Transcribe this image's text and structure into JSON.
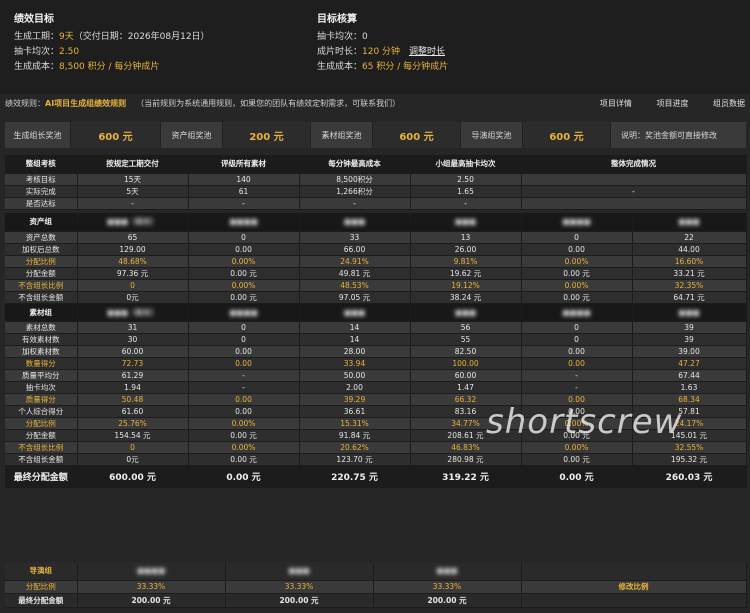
{
  "goal": {
    "title": "绩效目标",
    "rows": [
      {
        "label": "生成工期：",
        "value": "9天",
        "extra": "（交付日期：2026年08月12日）"
      },
      {
        "label": "抽卡均次：",
        "value": "2.50",
        "extra": ""
      },
      {
        "label": "生成成本：",
        "value": "8,500 积分 / 每分钟成片",
        "extra": ""
      }
    ]
  },
  "accounting": {
    "title": "目标核算",
    "rows": [
      {
        "label": "抽卡均次：",
        "value": "0",
        "link": ""
      },
      {
        "label": "成片时长：",
        "value": "120 分钟",
        "link": "调整时长"
      },
      {
        "label": "生成成本：",
        "value": "65 积分 / 每分钟成片",
        "link": ""
      }
    ]
  },
  "rules": {
    "label": "绩效规则：",
    "name": "AI项目生成组绩效规则",
    "note": "（当前规则为系统通用规则，如果您的团队有绩效定制需求，可联系我们）",
    "links": [
      "项目详情",
      "项目进度",
      "组员数据"
    ]
  },
  "pools": [
    {
      "label": "生成组长奖池",
      "value": "600 元"
    },
    {
      "label": "资产组奖池",
      "value": "200 元"
    },
    {
      "label": "素材组奖池",
      "value": "600 元"
    },
    {
      "label": "导演组奖池",
      "value": "600 元"
    }
  ],
  "pool_note": "说明：奖池金额可直接修改",
  "assessment": {
    "headers": [
      "整组考核",
      "按规定工期交付",
      "评级所有素材",
      "每分钟最高成本",
      "小组最高抽卡均次",
      "整体完成情况"
    ],
    "rows": [
      {
        "label": "考核目标",
        "cells": [
          "15天",
          "140",
          "8,500积分",
          "2.50",
          ""
        ]
      },
      {
        "label": "实际完成",
        "cells": [
          "5天",
          "61",
          "1,266积分",
          "1.65",
          "-"
        ]
      },
      {
        "label": "是否达标",
        "cells": [
          "-",
          "-",
          "-",
          "-",
          ""
        ]
      }
    ]
  },
  "asset_group": {
    "title": "资产组",
    "members": [
      "■■■（组长）",
      "■■■■",
      "■■■",
      "■■■",
      "■■■■",
      "■■■"
    ],
    "rows": [
      {
        "label": "资产总数",
        "gold": false,
        "cells": [
          "65",
          "0",
          "33",
          "13",
          "0",
          "22"
        ]
      },
      {
        "label": "加权后总数",
        "gold": false,
        "cells": [
          "129.00",
          "0.00",
          "66.00",
          "26.00",
          "0.00",
          "44.00"
        ]
      },
      {
        "label": "分配比例",
        "gold": true,
        "cells": [
          "48.68%",
          "0.00%",
          "24.91%",
          "9.81%",
          "0.00%",
          "16.60%"
        ]
      },
      {
        "label": "分配金额",
        "gold": false,
        "cells": [
          "97.36 元",
          "0.00 元",
          "49.81 元",
          "19.62 元",
          "0.00 元",
          "33.21 元"
        ]
      },
      {
        "label": "不含组长比例",
        "gold": true,
        "cells": [
          "0",
          "0.00%",
          "48.53%",
          "19.12%",
          "0.00%",
          "32.35%"
        ]
      },
      {
        "label": "不含组长金额",
        "gold": false,
        "cells": [
          "0元",
          "0.00 元",
          "97.05 元",
          "38.24 元",
          "0.00 元",
          "64.71 元"
        ]
      }
    ]
  },
  "material_group": {
    "title": "素材组",
    "members": [
      "■■■（组长）",
      "■■■■",
      "■■■",
      "■■■",
      "■■■■",
      "■■■"
    ],
    "rows": [
      {
        "label": "素材总数",
        "gold": false,
        "cells": [
          "31",
          "0",
          "14",
          "56",
          "0",
          "39"
        ]
      },
      {
        "label": "有效素材数",
        "gold": false,
        "cells": [
          "30",
          "0",
          "14",
          "55",
          "0",
          "39"
        ]
      },
      {
        "label": "加权素材数",
        "gold": false,
        "cells": [
          "60.00",
          "0.00",
          "28.00",
          "82.50",
          "0.00",
          "39.00"
        ]
      },
      {
        "label": "数量得分",
        "gold": true,
        "cells": [
          "72.73",
          "0.00",
          "33.94",
          "100.00",
          "0.00",
          "47.27"
        ]
      },
      {
        "label": "质量平均分",
        "gold": false,
        "cells": [
          "61.29",
          "-",
          "50.00",
          "60.00",
          "-",
          "67.44"
        ]
      },
      {
        "label": "抽卡均次",
        "gold": false,
        "cells": [
          "1.94",
          "-",
          "2.00",
          "1.47",
          "-",
          "1.63"
        ]
      },
      {
        "label": "质量得分",
        "gold": true,
        "cells": [
          "50.48",
          "0.00",
          "39.29",
          "66.32",
          "0.00",
          "68.34"
        ]
      },
      {
        "label": "个人综合得分",
        "gold": false,
        "cells": [
          "61.60",
          "0.00",
          "36.61",
          "83.16",
          "0.00",
          "57.81"
        ]
      },
      {
        "label": "分配比例",
        "gold": true,
        "cells": [
          "25.76%",
          "0.00%",
          "15.31%",
          "34.77%",
          "0.00%",
          "24.17%"
        ]
      },
      {
        "label": "分配金额",
        "gold": false,
        "cells": [
          "154.54 元",
          "0.00 元",
          "91.84 元",
          "208.61 元",
          "0.00 元",
          "145.01 元"
        ]
      },
      {
        "label": "不含组长比例",
        "gold": true,
        "cells": [
          "0",
          "0.00%",
          "20.62%",
          "46.83%",
          "0.00%",
          "32.55%"
        ]
      },
      {
        "label": "不含组长金额",
        "gold": false,
        "cells": [
          "0元",
          "0.00 元",
          "123.70 元",
          "280.98 元",
          "0.00 元",
          "195.32 元"
        ]
      }
    ]
  },
  "final": {
    "label": "最终分配金额",
    "cells": [
      "600.00 元",
      "0.00 元",
      "220.75 元",
      "319.22 元",
      "0.00 元",
      "260.03 元"
    ]
  },
  "director_group": {
    "title": "导演组",
    "members": [
      "■■■■",
      "■■■",
      "■■■"
    ],
    "ratio_label": "分配比例",
    "ratios": [
      "33.33%",
      "33.33%",
      "33.33%"
    ],
    "modify_label": "修改比例",
    "final_label": "最终分配金额",
    "finals": [
      "200.00 元",
      "200.00 元",
      "200.00 元"
    ]
  },
  "watermark": "shortscrew"
}
